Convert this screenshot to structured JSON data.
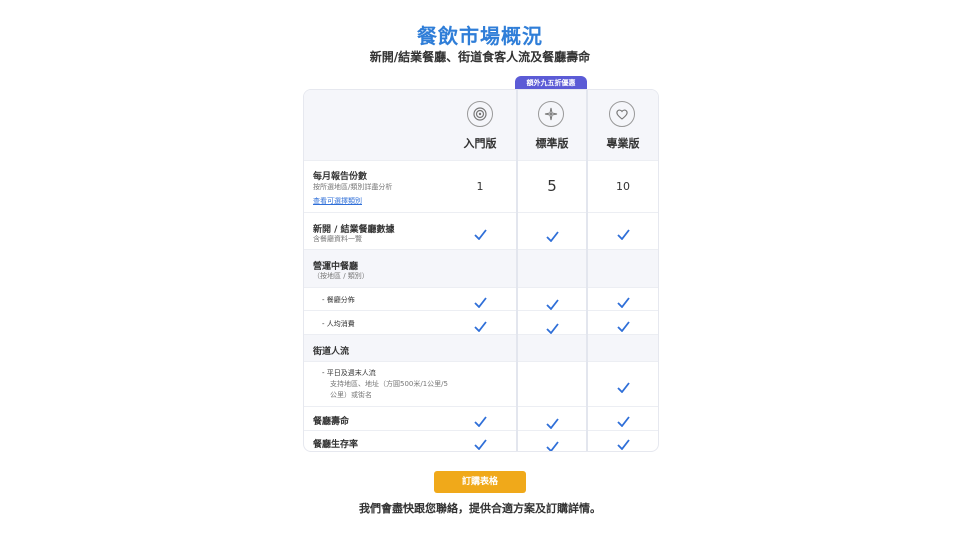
{
  "header": {
    "title": "餐飲市場概況",
    "subtitle": "新開/結業餐廳、街道食客人流及餐廳壽命"
  },
  "badge": "額外九五折優惠",
  "plans": [
    {
      "name": "入門版",
      "icon": "target-icon"
    },
    {
      "name": "標準版",
      "icon": "sparkle-icon"
    },
    {
      "name": "專業版",
      "icon": "handshake-heart-icon"
    }
  ],
  "rows": {
    "reports": {
      "label": "每月報告份數",
      "sub": "按所選地區/類別詳盡分析",
      "link": "查看可選擇類別",
      "values": [
        "1",
        "5",
        "10"
      ]
    },
    "open_close": {
      "label": "新開 / 結業餐廳數據",
      "sub": "含餐廳資料一覽"
    },
    "operating": {
      "label": "營運中餐廳",
      "sub": "（按地區 / 類別）"
    },
    "distribution": {
      "label": "- 餐廳分佈"
    },
    "spend": {
      "label": "- 人均消費"
    },
    "street": {
      "label": "街道人流"
    },
    "weekday": {
      "label": "- 平日及週末人流",
      "sub": "支持地區、地址（方圓500米/1公里/5公里）或街名"
    },
    "lifespan": {
      "label": "餐廳壽命"
    },
    "survival": {
      "label": "餐廳生存率"
    }
  },
  "cta": {
    "label": "訂購表格"
  },
  "footer": "我們會盡快跟您聯絡，提供合適方案及訂購詳情。",
  "colors": {
    "accent": "#2f7ed8",
    "check": "#2f6fd8",
    "badge": "#5b5bd6",
    "button": "#f0a91a"
  }
}
